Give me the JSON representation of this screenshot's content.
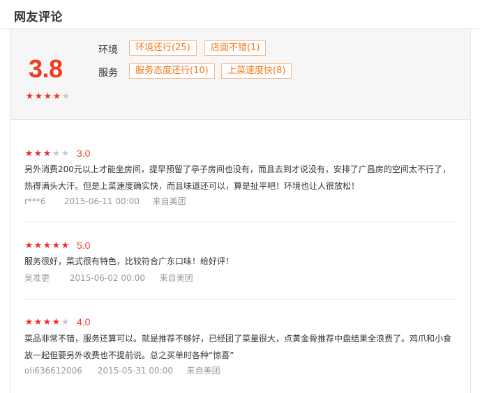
{
  "page": {
    "title": "网友评论"
  },
  "summary": {
    "score": "3.8",
    "stars": [
      1,
      1,
      1,
      1,
      0
    ],
    "rows": [
      {
        "label": "环境",
        "tags": [
          "环境还行(25)",
          "店面不错(1)"
        ]
      },
      {
        "label": "服务",
        "tags": [
          "服务态度还行(10)",
          "上菜速度快(8)"
        ]
      }
    ]
  },
  "reviews": [
    {
      "stars": [
        1,
        1,
        1,
        0,
        0
      ],
      "score": "3.0",
      "lines": [
        "另外消费200元以上才能坐房间，提早预留了亭子房间也没有，而且去到才说没有，安排了广昌房的空间太不行了，",
        "热得满头大汗。但是上菜速度确实快，而且味道还可以，算是扯平吧！环境也让人很放松！"
      ],
      "user": "r***6",
      "date": "2015-06-11 00:00",
      "source": "来自美团"
    },
    {
      "stars": [
        1,
        1,
        1,
        1,
        1
      ],
      "score": "5.0",
      "lines": [
        "服务很好，菜式很有特色，比较符合广东口味！给好评！"
      ],
      "user": "吴准更",
      "date": "2015-06-02 00:00",
      "source": "来自美团"
    },
    {
      "stars": [
        1,
        1,
        1,
        1,
        0
      ],
      "score": "4.0",
      "lines": [
        "菜品非常不错，服务还算可以。就是推荐不够好，已经团了菜量很大，点黄金骨推荐中盘结果全浪费了。鸡爪和小食",
        "放一起但要另外收费也不提前说。总之买单时各种“惊喜”"
      ],
      "user": "oIi636612006",
      "date": "2015-05-31 00:00",
      "source": "来自美团"
    }
  ],
  "colors": {
    "accent": "#ef3a1e",
    "tag_text": "#f07c22",
    "tag_border": "#f5b88d",
    "star_on": "#ef2a2a",
    "star_off": "#c9c9c9"
  },
  "icons": {
    "star": "star-icon"
  }
}
